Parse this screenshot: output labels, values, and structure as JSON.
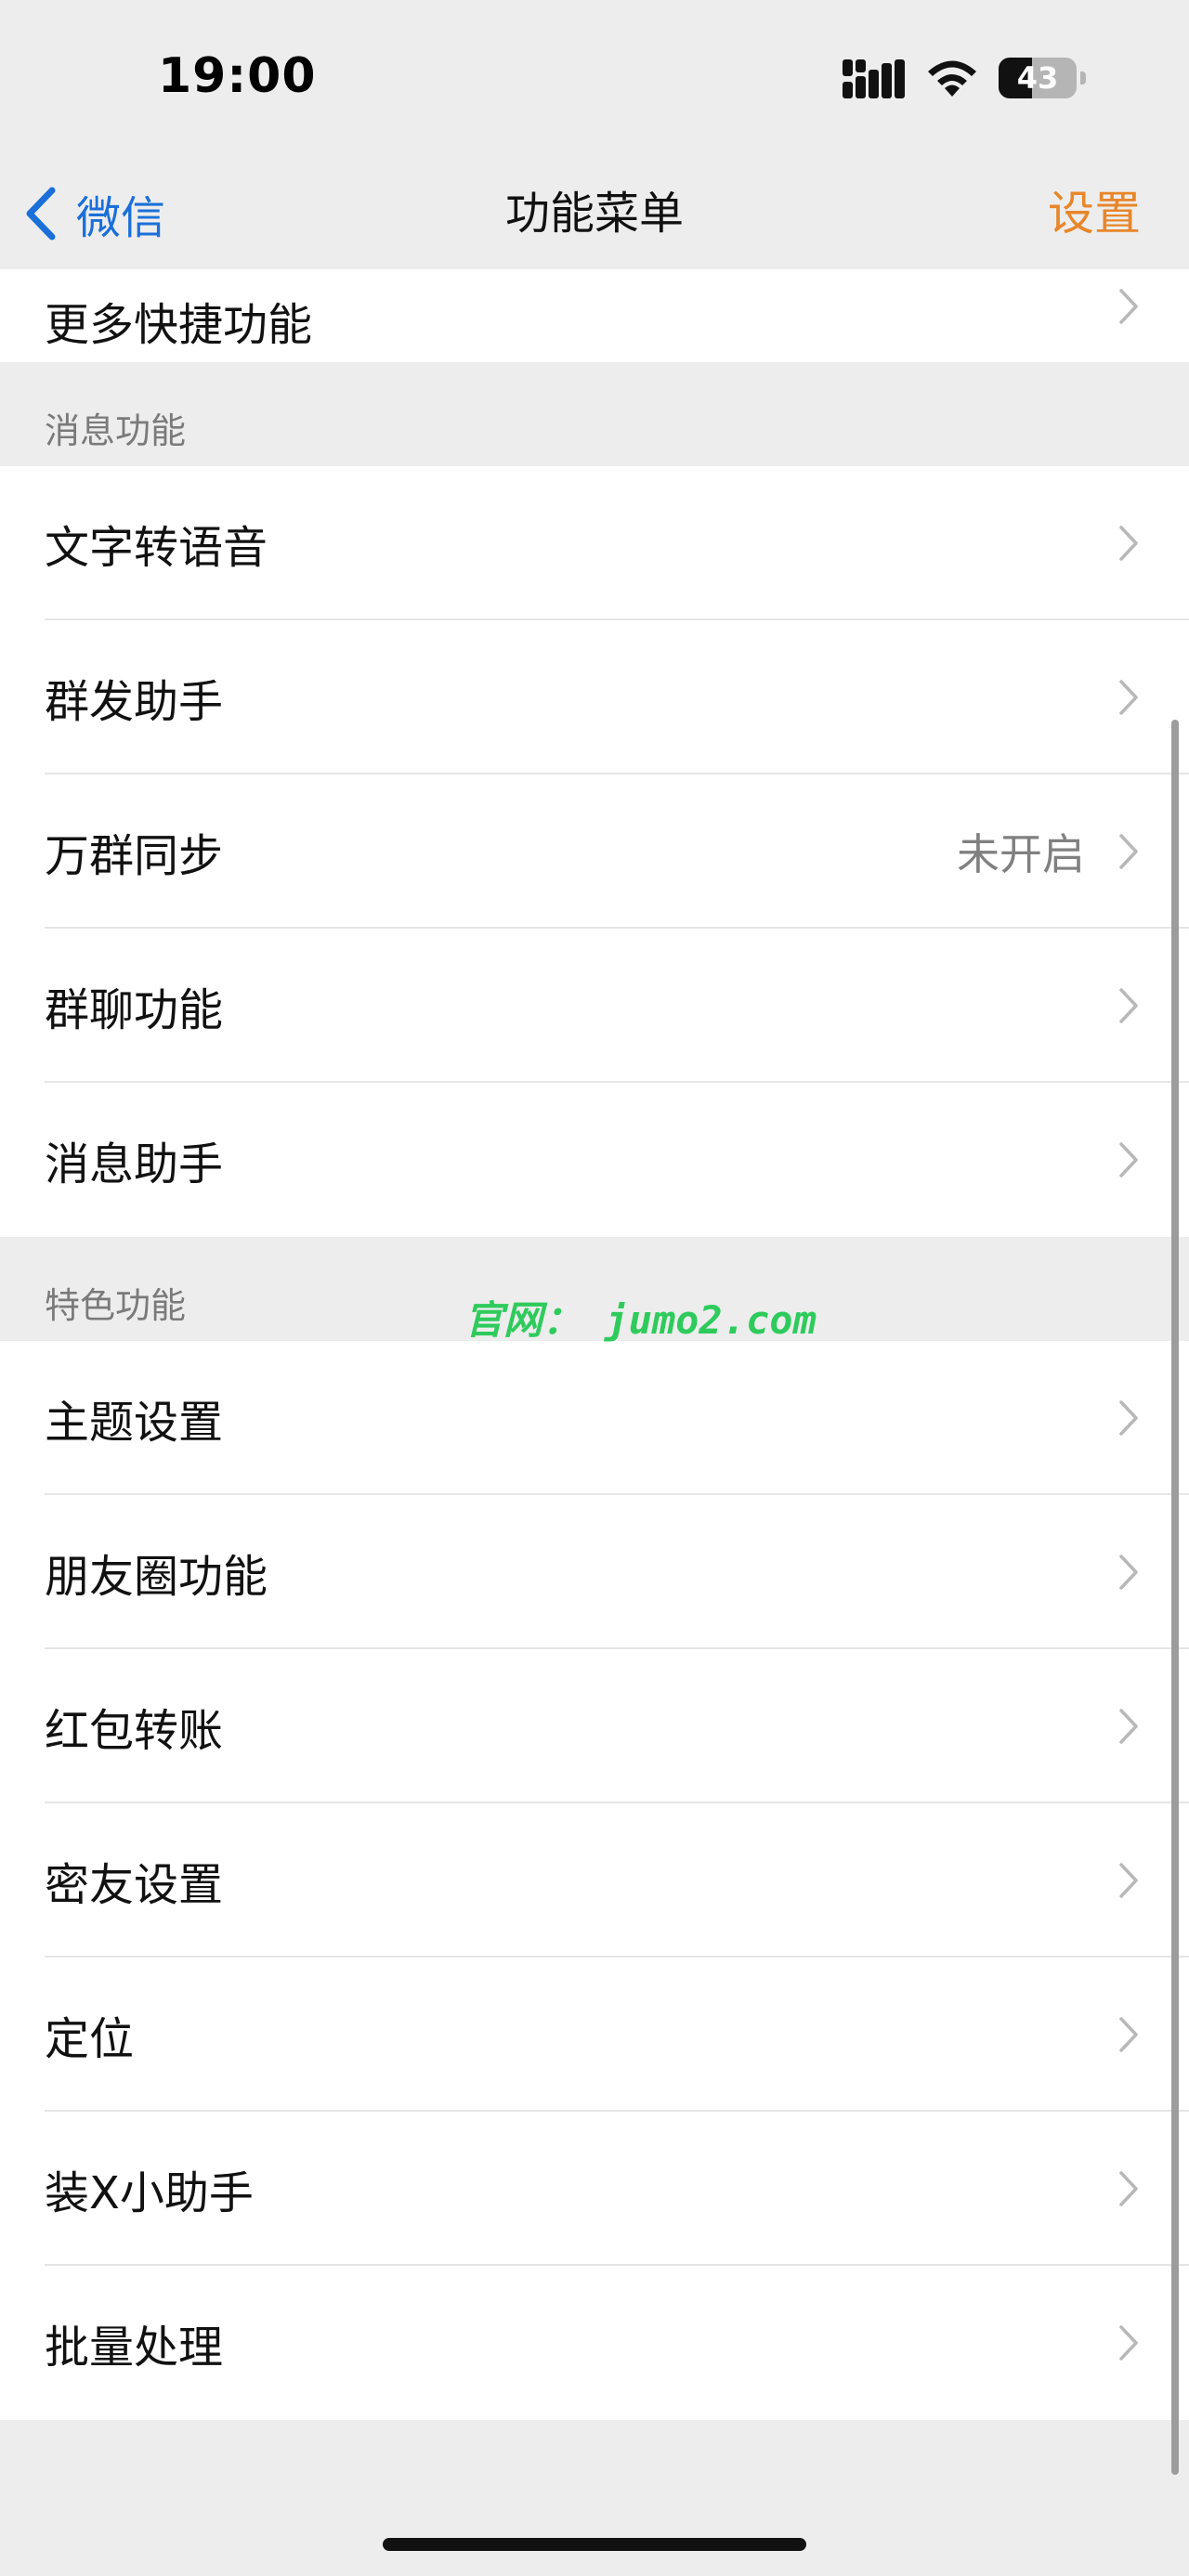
{
  "status_bar": {
    "time": "19:00",
    "battery_level": "43",
    "battery_fraction": 0.43
  },
  "nav": {
    "back_label": "微信",
    "title": "功能菜单",
    "action_label": "设置"
  },
  "colors": {
    "accent_blue": "#1a6fd9",
    "accent_orange": "#e8862a",
    "watermark_green": "#2ecb5c",
    "background": "#ededed"
  },
  "top_partial_item": {
    "label": "更多快捷功能"
  },
  "sections": [
    {
      "header": "消息功能",
      "items": [
        {
          "label": "文字转语音",
          "value": ""
        },
        {
          "label": "群发助手",
          "value": ""
        },
        {
          "label": "万群同步",
          "value": "未开启"
        },
        {
          "label": "群聊功能",
          "value": ""
        },
        {
          "label": "消息助手",
          "value": ""
        }
      ]
    },
    {
      "header": "特色功能",
      "items": [
        {
          "label": "主题设置",
          "value": ""
        },
        {
          "label": "朋友圈功能",
          "value": ""
        },
        {
          "label": "红包转账",
          "value": ""
        },
        {
          "label": "密友设置",
          "value": ""
        },
        {
          "label": "定位",
          "value": ""
        },
        {
          "label": "装X小助手",
          "value": ""
        },
        {
          "label": "批量处理",
          "value": ""
        }
      ]
    }
  ],
  "watermark": "官网： jumo2.com",
  "icons": {
    "signal": "cellular-signal-icon",
    "wifi": "wifi-icon",
    "back": "chevron-left-icon",
    "row": "chevron-right-icon"
  }
}
